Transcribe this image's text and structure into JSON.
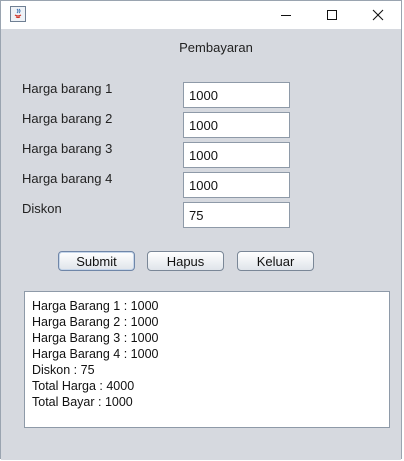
{
  "window": {
    "title": ""
  },
  "form": {
    "heading": "Pembayaran",
    "fields": [
      {
        "label": "Harga barang 1",
        "value": "1000"
      },
      {
        "label": "Harga barang 2",
        "value": "1000"
      },
      {
        "label": "Harga barang 3",
        "value": "1000"
      },
      {
        "label": "Harga barang 4",
        "value": "1000"
      },
      {
        "label": "Diskon",
        "value": "75"
      }
    ]
  },
  "buttons": {
    "submit": "Submit",
    "hapus": "Hapus",
    "keluar": "Keluar"
  },
  "output": {
    "lines": [
      "Harga Barang 1 : 1000",
      "Harga Barang 2 : 1000",
      "Harga Barang 3 : 1000",
      "Harga Barang 4 : 1000",
      "Diskon : 75",
      "Total Harga : 4000",
      "Total Bayar : 1000"
    ]
  }
}
